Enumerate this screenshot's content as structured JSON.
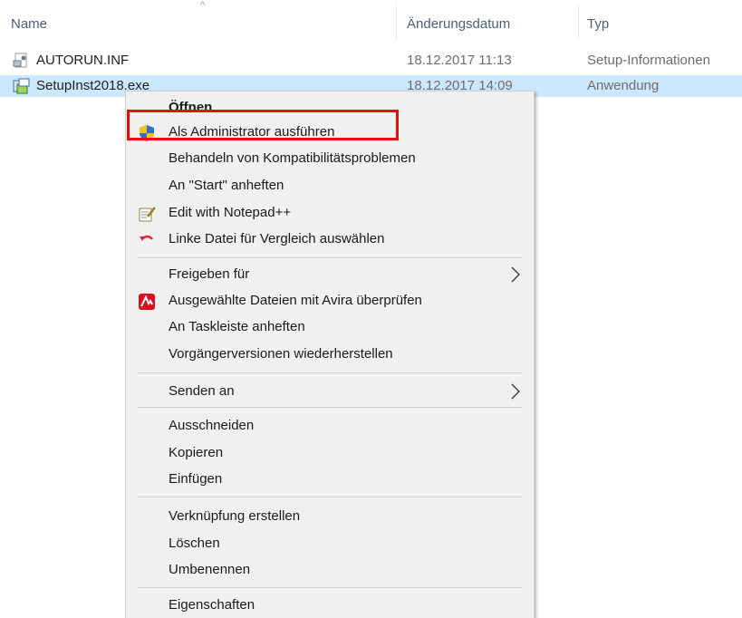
{
  "header": {
    "sort_caret": "^",
    "col_name": "Name",
    "col_date": "Änderungsdatum",
    "col_type": "Typ"
  },
  "files": [
    {
      "name": "AUTORUN.INF",
      "date": "18.12.2017 11:13",
      "type": "Setup-Informationen",
      "icon": "inf-file-icon"
    },
    {
      "name": "SetupInst2018.exe",
      "date": "18.12.2017 14:09",
      "type": "Anwendung",
      "icon": "installer-icon",
      "selected": true
    }
  ],
  "context_menu": {
    "items": [
      {
        "label": "Öffnen",
        "bold": true
      },
      {
        "label": "Als Administrator ausführen",
        "icon": "uac-shield-icon",
        "highlighted": true
      },
      {
        "label": "Behandeln von Kompatibilitätsproblemen"
      },
      {
        "label": "An \"Start\" anheften"
      },
      {
        "label": "Edit with Notepad++",
        "icon": "notepad-plus-plus-icon"
      },
      {
        "label": "Linke Datei für Vergleich auswählen",
        "icon": "compare-undo-icon"
      },
      {
        "label": "Freigeben für",
        "submenu": true
      },
      {
        "label": "Ausgewählte Dateien mit Avira überprüfen",
        "icon": "avira-icon"
      },
      {
        "label": "An Taskleiste anheften"
      },
      {
        "label": "Vorgängerversionen wiederherstellen"
      },
      {
        "label": "Senden an",
        "submenu": true
      },
      {
        "label": "Ausschneiden"
      },
      {
        "label": "Kopieren"
      },
      {
        "label": "Einfügen"
      },
      {
        "label": "Verknüpfung erstellen"
      },
      {
        "label": "Löschen"
      },
      {
        "label": "Umbenennen"
      },
      {
        "label": "Eigenschaften"
      }
    ]
  },
  "colors": {
    "selection": "#cce8ff",
    "menu_background": "#f0f0f0",
    "highlight_border": "#e01010",
    "header_text": "#4c607a"
  }
}
